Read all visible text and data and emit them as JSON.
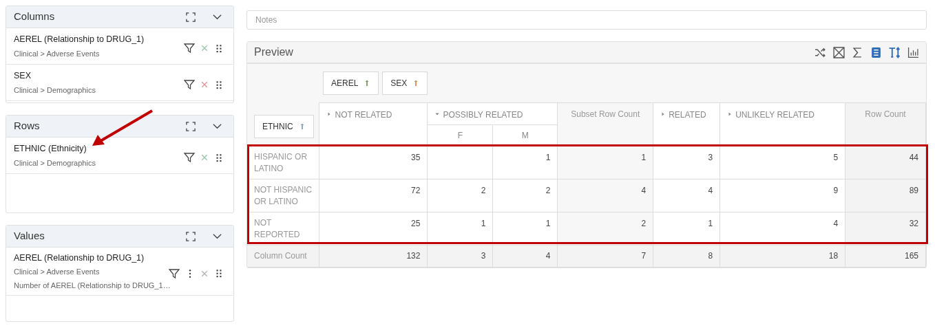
{
  "panels": [
    {
      "title": "Columns",
      "items": [
        {
          "name": "AEREL (Relationship to DRUG_1)",
          "path": "Clinical > Adverse Events",
          "menu": false,
          "color": "#9cc7b0"
        },
        {
          "name": "SEX",
          "path": "Clinical > Demographics",
          "menu": false,
          "color": "#e39a9a"
        }
      ]
    },
    {
      "title": "Rows",
      "items": [
        {
          "name": "ETHNIC (Ethnicity)",
          "path": "Clinical > Demographics",
          "menu": false,
          "color": "#9cc7b0"
        }
      ]
    },
    {
      "title": "Values",
      "items": [
        {
          "name": "AEREL (Relationship to DRUG_1)",
          "path": "Clinical > Adverse Events",
          "detail": "Number of AEREL (Relationship to DRUG_1…",
          "menu": true,
          "color": "#b5b5b5"
        }
      ]
    }
  ],
  "notes": {
    "placeholder": "Notes"
  },
  "preview": {
    "title": "Preview",
    "tools": [
      {
        "kind": "shuffle",
        "active": false
      },
      {
        "kind": "expand",
        "active": false
      },
      {
        "kind": "sum",
        "active": false
      },
      {
        "kind": "table",
        "active": true
      },
      {
        "kind": "text-height",
        "active": true
      },
      {
        "kind": "bar-chart",
        "active": false
      }
    ],
    "row_fields": [
      {
        "label": "ETHNIC",
        "color": "#8fa9c8"
      }
    ],
    "column_fields": [
      {
        "label": "AEREL",
        "color": "#7fa36f"
      },
      {
        "label": "SEX",
        "color": "#d9955a"
      }
    ],
    "headers": [
      {
        "label": "NOT RELATED",
        "kind": "group",
        "expanded": false
      },
      {
        "label": "POSSIBLY RELATED",
        "kind": "group",
        "expanded": true,
        "children": [
          "F",
          "M"
        ]
      },
      {
        "label": "Subset Row Count",
        "kind": "subtotal"
      },
      {
        "label": "RELATED",
        "kind": "group",
        "expanded": false
      },
      {
        "label": "UNLIKELY RELATED",
        "kind": "group",
        "expanded": false
      },
      {
        "label": "Row Count",
        "kind": "total"
      }
    ],
    "rows": [
      {
        "label": "HISPANIC OR LATINO",
        "cells": [
          "35",
          null,
          "1",
          "1",
          "3",
          "5",
          "44"
        ]
      },
      {
        "label": "NOT HISPANIC OR LATINO",
        "cells": [
          "72",
          "2",
          "2",
          "4",
          "4",
          "9",
          "89"
        ]
      },
      {
        "label": "NOT REPORTED",
        "cells": [
          "25",
          "1",
          "1",
          "2",
          "1",
          "4",
          "32"
        ]
      }
    ],
    "footer": {
      "label": "Column Count",
      "cells": [
        "132",
        "3",
        "4",
        "7",
        "8",
        "18",
        "165"
      ]
    }
  }
}
